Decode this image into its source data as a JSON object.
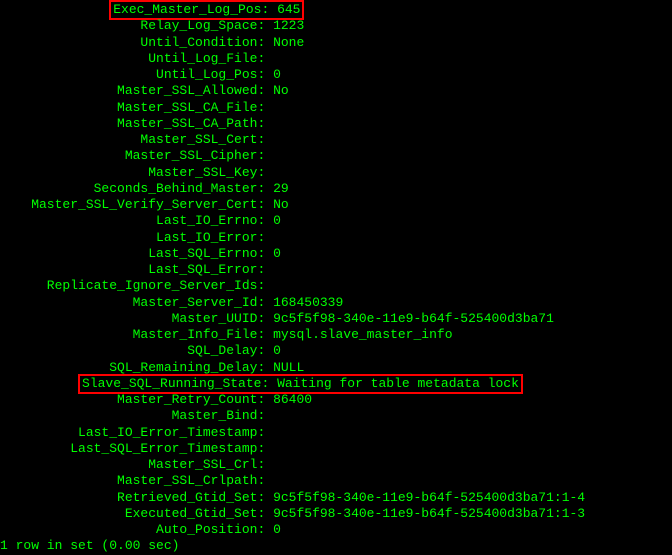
{
  "status": {
    "rows": [
      {
        "key": "Exec_Master_Log_Pos",
        "val": "645",
        "highlight": "both"
      },
      {
        "key": "Relay_Log_Space",
        "val": "1223"
      },
      {
        "key": "Until_Condition",
        "val": "None"
      },
      {
        "key": "Until_Log_File",
        "val": ""
      },
      {
        "key": "Until_Log_Pos",
        "val": "0"
      },
      {
        "key": "Master_SSL_Allowed",
        "val": "No"
      },
      {
        "key": "Master_SSL_CA_File",
        "val": ""
      },
      {
        "key": "Master_SSL_CA_Path",
        "val": ""
      },
      {
        "key": "Master_SSL_Cert",
        "val": ""
      },
      {
        "key": "Master_SSL_Cipher",
        "val": ""
      },
      {
        "key": "Master_SSL_Key",
        "val": ""
      },
      {
        "key": "Seconds_Behind_Master",
        "val": "29"
      },
      {
        "key": "Master_SSL_Verify_Server_Cert",
        "val": "No"
      },
      {
        "key": "Last_IO_Errno",
        "val": "0"
      },
      {
        "key": "Last_IO_Error",
        "val": ""
      },
      {
        "key": "Last_SQL_Errno",
        "val": "0"
      },
      {
        "key": "Last_SQL_Error",
        "val": ""
      },
      {
        "key": "Replicate_Ignore_Server_Ids",
        "val": ""
      },
      {
        "key": "Master_Server_Id",
        "val": "168450339"
      },
      {
        "key": "Master_UUID",
        "val": "9c5f5f98-340e-11e9-b64f-525400d3ba71"
      },
      {
        "key": "Master_Info_File",
        "val": "mysql.slave_master_info"
      },
      {
        "key": "SQL_Delay",
        "val": "0"
      },
      {
        "key": "SQL_Remaining_Delay",
        "val": "NULL"
      },
      {
        "key": "Slave_SQL_Running_State",
        "val": "Waiting for table metadata lock",
        "highlight": "row"
      },
      {
        "key": "Master_Retry_Count",
        "val": "86400"
      },
      {
        "key": "Master_Bind",
        "val": ""
      },
      {
        "key": "Last_IO_Error_Timestamp",
        "val": ""
      },
      {
        "key": "Last_SQL_Error_Timestamp",
        "val": ""
      },
      {
        "key": "Master_SSL_Crl",
        "val": ""
      },
      {
        "key": "Master_SSL_Crlpath",
        "val": ""
      },
      {
        "key": "Retrieved_Gtid_Set",
        "val": "9c5f5f98-340e-11e9-b64f-525400d3ba71:1-4"
      },
      {
        "key": "Executed_Gtid_Set",
        "val": "9c5f5f98-340e-11e9-b64f-525400d3ba71:1-3"
      },
      {
        "key": "Auto_Position",
        "val": "0"
      }
    ],
    "footer": "1 row in set (0.00 sec)"
  },
  "layout": {
    "key_width_chars": 33
  }
}
